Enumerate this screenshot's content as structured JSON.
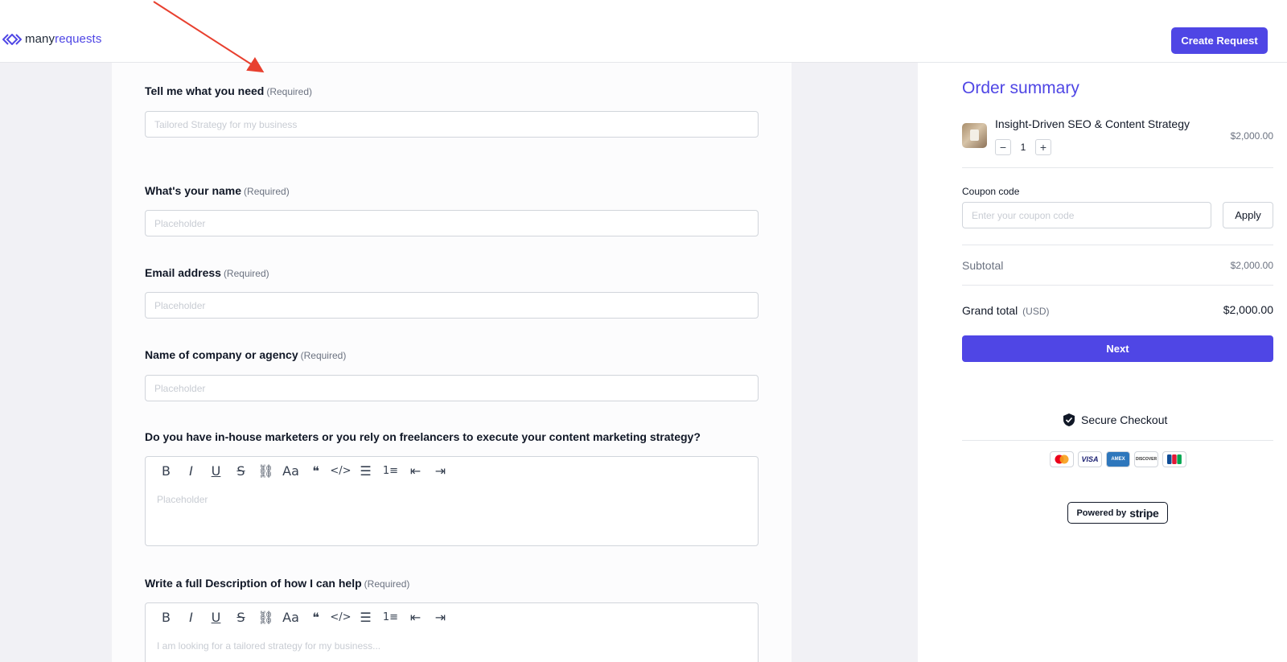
{
  "header": {
    "logo_part1": "many",
    "logo_part2": "requests",
    "create_request_label": "Create Request"
  },
  "form": {
    "fields": [
      {
        "label": "Tell me what you need",
        "required": "(Required)",
        "placeholder": "Tailored Strategy for my business"
      },
      {
        "label": "What's your name",
        "required": "(Required)",
        "placeholder": "Placeholder"
      },
      {
        "label": "Email address",
        "required": "(Required)",
        "placeholder": "Placeholder"
      },
      {
        "label": "Name of company or agency",
        "required": "(Required)",
        "placeholder": "Placeholder"
      }
    ],
    "editors": [
      {
        "label": "Do you have in-house marketers or you rely on freelancers to execute your content marketing strategy?",
        "placeholder": "Placeholder"
      },
      {
        "label": "Write a full Description of how I can help",
        "required": "(Required)",
        "placeholder": "I am looking for a tailored strategy for my business..."
      }
    ],
    "toolbar_icons": [
      "bold-icon",
      "italic-icon",
      "underline-icon",
      "strikethrough-icon",
      "link-icon",
      "font-size-icon",
      "blockquote-icon",
      "code-icon",
      "bullet-list-icon",
      "numbered-list-icon",
      "outdent-icon",
      "indent-icon"
    ]
  },
  "order": {
    "title": "Order summary",
    "product_name": "Insight-Driven SEO & Content Strategy",
    "quantity": "1",
    "product_price": "$2,000.00",
    "coupon_label": "Coupon code",
    "coupon_placeholder": "Enter your coupon code",
    "apply_label": "Apply",
    "subtotal_label": "Subtotal",
    "subtotal_value": "$2,000.00",
    "grand_total_label": "Grand total",
    "currency": "(USD)",
    "grand_total_value": "$2,000.00",
    "next_label": "Next",
    "secure_label": "Secure Checkout",
    "cards": [
      "mastercard-icon",
      "visa-icon",
      "amex-icon",
      "discover-icon",
      "jcb-icon"
    ],
    "powered_by": "Powered by",
    "stripe": "stripe"
  },
  "colors": {
    "accent": "#4f46e5",
    "annotation_arrow": "#e8402f"
  }
}
